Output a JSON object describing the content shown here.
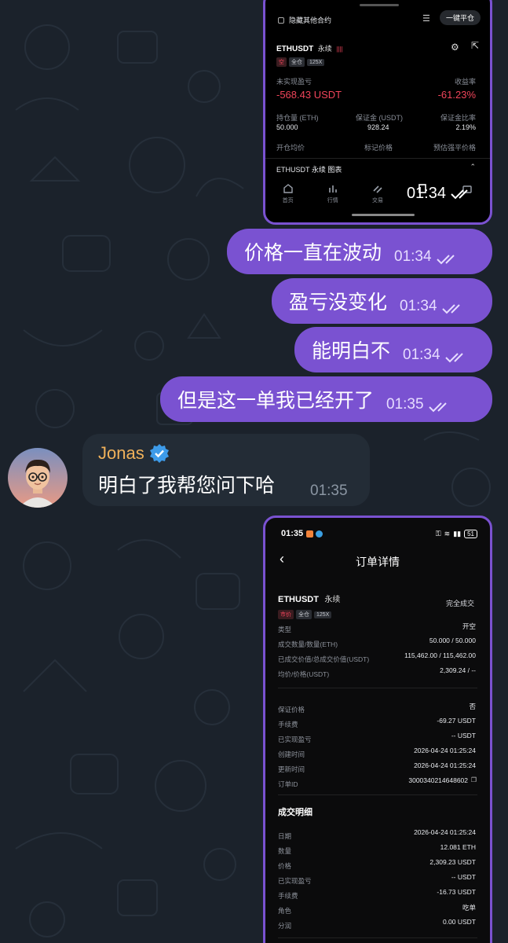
{
  "screenshot_top": {
    "hide_others_label": "隐藏其他合约",
    "one_click_close": "一键平仓",
    "symbol": "ETHUSDT",
    "contract_type": "永续",
    "chip_side": "空",
    "chip_margin": "全仓",
    "chip_leverage": "125X",
    "unrealized_label": "未实现盈亏",
    "unrealized_value": "-568.43 USDT",
    "roi_label": "收益率",
    "roi_value": "-61.23%",
    "position_label": "持仓量 (ETH)",
    "position_value": "50.000",
    "margin_label": "保证金 (USDT)",
    "margin_value": "928.24",
    "margin_ratio_label": "保证金比率",
    "margin_ratio_value": "2.19%",
    "open_price_label": "开仓均价",
    "mark_price_label": "标记价格",
    "liq_price_label": "预估强平价格",
    "chart_label": "ETHUSDT 永续 图表",
    "nav": [
      "首页",
      "行情",
      "交易",
      "",
      ""
    ],
    "time": "01:34"
  },
  "messages_out": [
    {
      "text": "价格一直在波动",
      "time": "01:34"
    },
    {
      "text": "盈亏没变化",
      "time": "01:34"
    },
    {
      "text": "能明白不",
      "time": "01:34"
    },
    {
      "text": "但是这一单我已经开了",
      "time": "01:35"
    }
  ],
  "message_in": {
    "sender": "Jonas",
    "text": "明白了我帮您问下哈",
    "time": "01:35"
  },
  "screenshot_bottom": {
    "status_time": "01:35",
    "battery": "51",
    "title": "订单详情",
    "symbol": "ETHUSDT",
    "contract_type": "永续",
    "status": "完全成交",
    "chip_type": "市价",
    "chip_margin": "全仓",
    "chip_leverage": "125X",
    "details": [
      {
        "k": "类型",
        "v": "开空",
        "red": true
      },
      {
        "k": "成交数量/数量(ETH)",
        "v": "50.000 / 50.000"
      },
      {
        "k": "已成交价值/总成交价值(USDT)",
        "v": "115,462.00 / 115,462.00"
      },
      {
        "k": "均价/价格(USDT)",
        "v": "2,309.24 / --"
      }
    ],
    "details2": [
      {
        "k": "保证价格",
        "v": "否"
      },
      {
        "k": "手续费",
        "v": "-69.27 USDT"
      },
      {
        "k": "已实现盈亏",
        "v": "-- USDT"
      },
      {
        "k": "创建时间",
        "v": "2026-04-24 01:25:24"
      },
      {
        "k": "更新时间",
        "v": "2026-04-24 01:25:24"
      },
      {
        "k": "订单ID",
        "v": "3000340214648602"
      }
    ],
    "fills_title": "成交明细",
    "fills": [
      {
        "k": "日期",
        "v": "2026-04-24 01:25:24"
      },
      {
        "k": "数量",
        "v": "12.081 ETH"
      },
      {
        "k": "价格",
        "v": "2,309.23 USDT"
      },
      {
        "k": "已实现盈亏",
        "v": "-- USDT"
      },
      {
        "k": "手续费",
        "v": "-16.73 USDT"
      },
      {
        "k": "角色",
        "v": "吃单"
      },
      {
        "k": "分润",
        "v": "0.00 USDT"
      }
    ]
  },
  "colors": {
    "background": "#1b222b",
    "outgoing_bubble": "#7a52d1",
    "incoming_bubble": "#232c36",
    "loss_red": "#f0445a",
    "sender_name": "#f0b15a",
    "verified_badge": "#3d9be9"
  }
}
